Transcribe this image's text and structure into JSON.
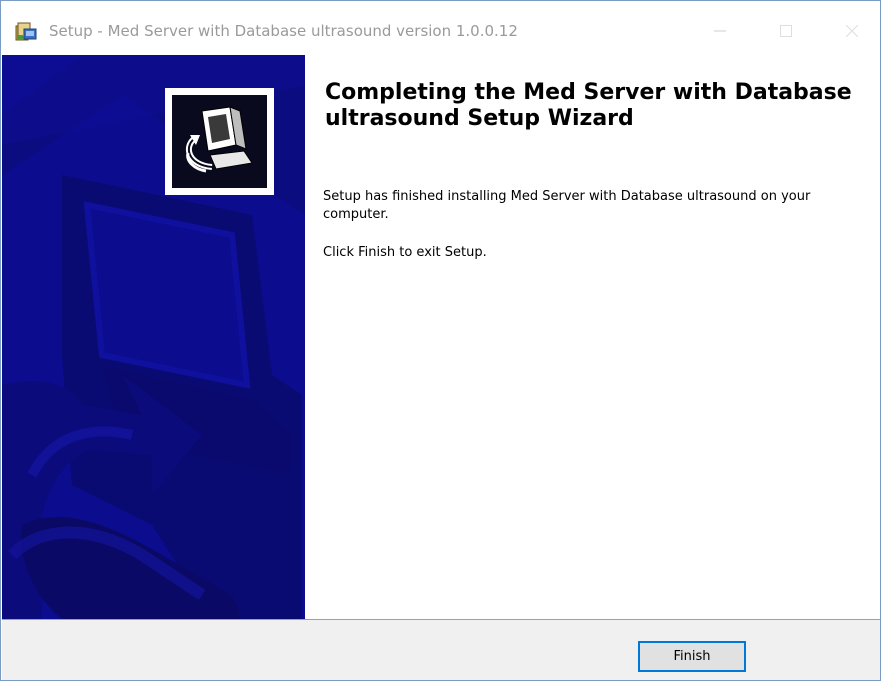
{
  "window": {
    "title": "Setup - Med Server with Database ultrasound version 1.0.0.12",
    "icon": "installer-icon",
    "controls": [
      "minimize-icon",
      "maximize-icon",
      "close-icon"
    ]
  },
  "side_panel": {
    "background_color": "#0c0c8f",
    "logo": "setup-computer-logo"
  },
  "content": {
    "heading": "Completing the Med Server with Database ultrasound Setup Wizard",
    "message": "Setup has finished installing Med Server with Database ultrasound on your computer.",
    "instruction": "Click Finish to exit Setup."
  },
  "footer": {
    "finish_label": "Finish",
    "accent_color": "#0078d7"
  }
}
